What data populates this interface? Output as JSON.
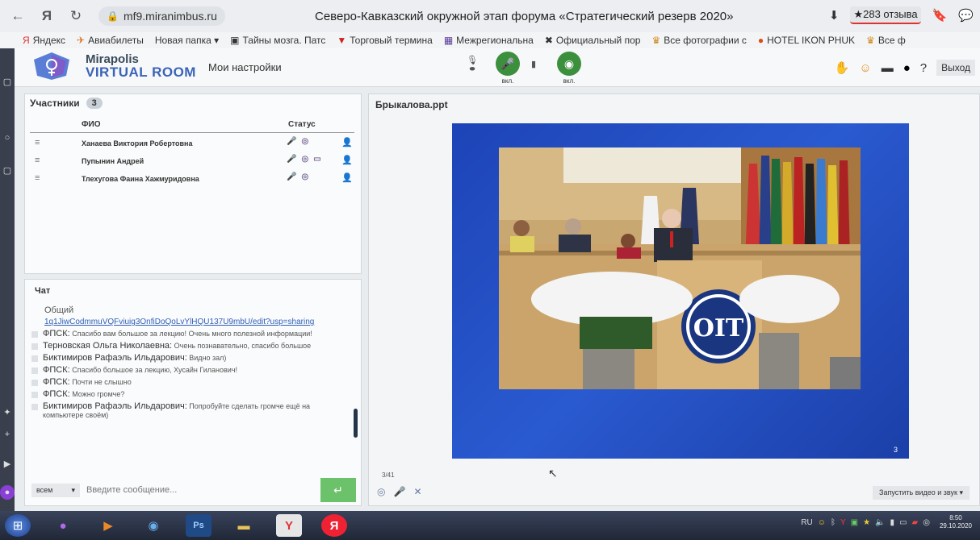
{
  "browser": {
    "url": "mf9.miranimbus.ru",
    "title": "Северо-Кавказский окружной этап форума «Стратегический резерв 2020»",
    "reviews": "★283 отзыва"
  },
  "bookmarks": [
    "Яндекс",
    "Авиабилеты",
    "Новая папка ▾",
    "Тайны мозга. Патс",
    "Торговый термина",
    "Межрегиональна",
    "Официальный пор",
    "Все фотографии с",
    "HOTEL IKON PHUK",
    "Все ф"
  ],
  "app": {
    "logo_line1": "Mirapolis",
    "logo_line2": "VIRTUAL ROOM",
    "settings": "Мои настройки",
    "mic_label": "вкл.",
    "cam_label": "вкл.",
    "exit": "Выход"
  },
  "participants": {
    "title": "Участники",
    "count": "3",
    "col_name": "ФИО",
    "col_status": "Статус",
    "rows": [
      {
        "name": "Ханаева Виктория Робертовна"
      },
      {
        "name": "Пупынин Андрей"
      },
      {
        "name": "Тлехугова Фаина Хажмуридовна"
      }
    ]
  },
  "chat": {
    "title": "Чат",
    "channel": "Общий",
    "link": "1q1JiwCodmmuVQFviuig3OnfiDoQoLvYlHQU137U9mbU/edit?usp=sharing",
    "messages": [
      {
        "author": "ФПСК:",
        "text": "Спасибо вам большое за лекцию! Очень много полезной информации!"
      },
      {
        "author": "Терновская Ольга Николаевна:",
        "text": "Очень познавательно, спасибо большое"
      },
      {
        "author": "Биктимиров Рафаэль Ильдарович:",
        "text": "Видно зал)"
      },
      {
        "author": "ФПСК:",
        "text": "Спасибо большое за лекцию, Хусайн Гиланович!"
      },
      {
        "author": "ФПСК:",
        "text": "Почти не слышно"
      },
      {
        "author": "ФПСК:",
        "text": "Можно громче?"
      },
      {
        "author": "Биктимиров Рафаэль Ильдарович:",
        "text": "Попробуйте сделать громче ещё на компьютере своём)"
      }
    ],
    "scope": "всем",
    "input_placeholder": "Введите сообщение..."
  },
  "presentation": {
    "title": "Брыкалова.ppt",
    "slide_number": "3",
    "page_count": "3/41",
    "start_video": "Запустить видео и звук"
  },
  "taskbar": {
    "lang": "RU",
    "time": "8:50",
    "date": "29.10.2020"
  }
}
